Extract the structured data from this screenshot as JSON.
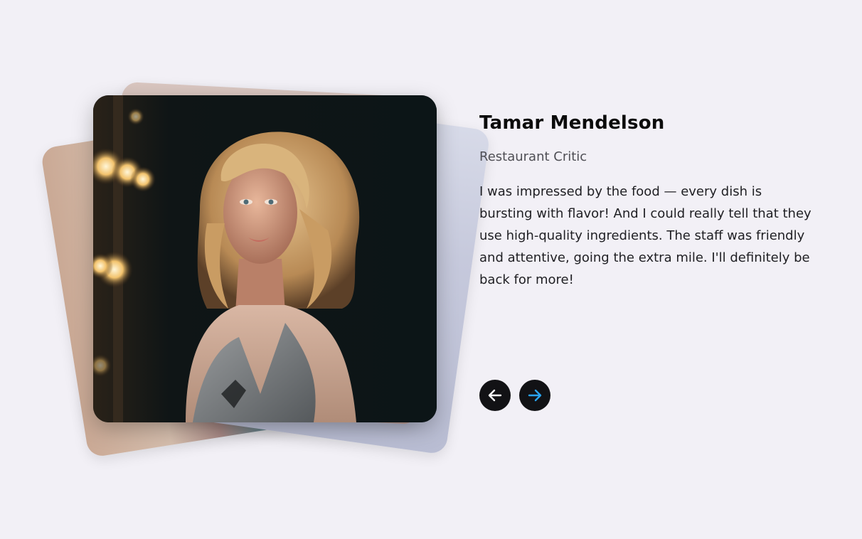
{
  "testimonial": {
    "name": "Tamar Mendelson",
    "role": "Restaurant Critic",
    "quote": "I was impressed by the food — every dish is bursting with flavor! And I could really tell that they use high-quality ingredients. The staff was friendly and attentive, going the extra mile. I'll definitely be back for more!"
  },
  "navigation": {
    "prev_icon": "arrow-left-icon",
    "next_icon": "arrow-right-icon"
  },
  "colors": {
    "background": "#f2f0f6",
    "button": "#121215",
    "prev_arrow": "#ffffff",
    "next_arrow": "#2aa3f0"
  },
  "photo": {
    "subject": "portrait-photo"
  }
}
